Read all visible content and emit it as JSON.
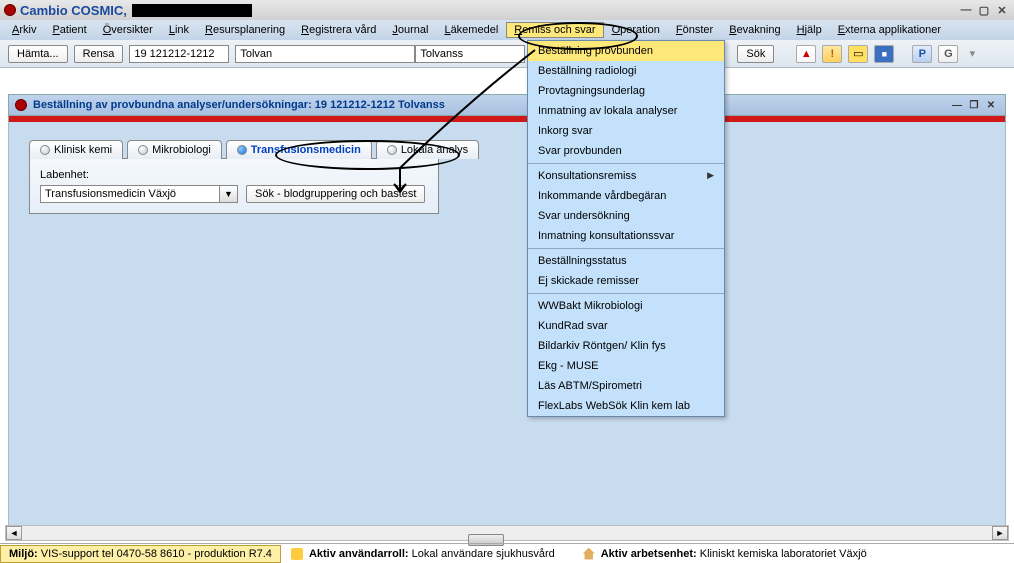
{
  "title": "Cambio COSMIC,",
  "menus": [
    "Arkiv",
    "Patient",
    "Översikter",
    "Link",
    "Resursplanering",
    "Registrera vård",
    "Journal",
    "Läkemedel",
    "Remiss och svar",
    "Operation",
    "Fönster",
    "Bevakning",
    "Hjälp",
    "Externa applikationer"
  ],
  "open_menu_index": 8,
  "toolbar": {
    "hamta": "Hämta...",
    "rensa": "Rensa",
    "id": "19 121212-1212",
    "firstname": "Tolvan",
    "lastname": "Tolvanss",
    "sok": "Sök"
  },
  "subwindow_title": "Beställning av provbundna analyser/undersökningar: 19 121212-1212 Tolvanss",
  "tabs": [
    "Klinisk kemi",
    "Mikrobiologi",
    "Transfusionsmedicin",
    "Lokala analys"
  ],
  "active_tab_index": 2,
  "panel": {
    "label": "Labenhet:",
    "combo_value": "Transfusionsmedicin Växjö",
    "button": "Sök - blodgruppering och bastest"
  },
  "dropdown": {
    "groups": [
      [
        "Beställning provbunden",
        "Beställning radiologi",
        "Provtagningsunderlag",
        "Inmatning av lokala analyser",
        "Inkorg svar",
        "Svar provbunden"
      ],
      [
        "Konsultationsremiss",
        "Inkommande vårdbegäran",
        "Svar undersökning",
        "Inmatning konsultationssvar"
      ],
      [
        "Beställningsstatus",
        "Ej skickade remisser"
      ],
      [
        "WWBakt Mikrobiologi",
        "KundRad svar",
        "Bildarkiv Röntgen/ Klin fys",
        "Ekg - MUSE",
        "Läs ABTM/Spirometri",
        "FlexLabs WebSök Klin kem lab"
      ]
    ],
    "highlighted": "Beställning provbunden",
    "submenu_items": [
      "Konsultationsremiss"
    ]
  },
  "status": {
    "miljo_label": "Miljö:",
    "miljo_value": "VIS-support tel 0470-58 8610 - produktion R7.4",
    "roll_label": "Aktiv användarroll:",
    "roll_value": "Lokal användare sjukhusvård",
    "enhet_label": "Aktiv arbetsenhet:",
    "enhet_value": "Kliniskt kemiska laboratoriet Växjö"
  }
}
